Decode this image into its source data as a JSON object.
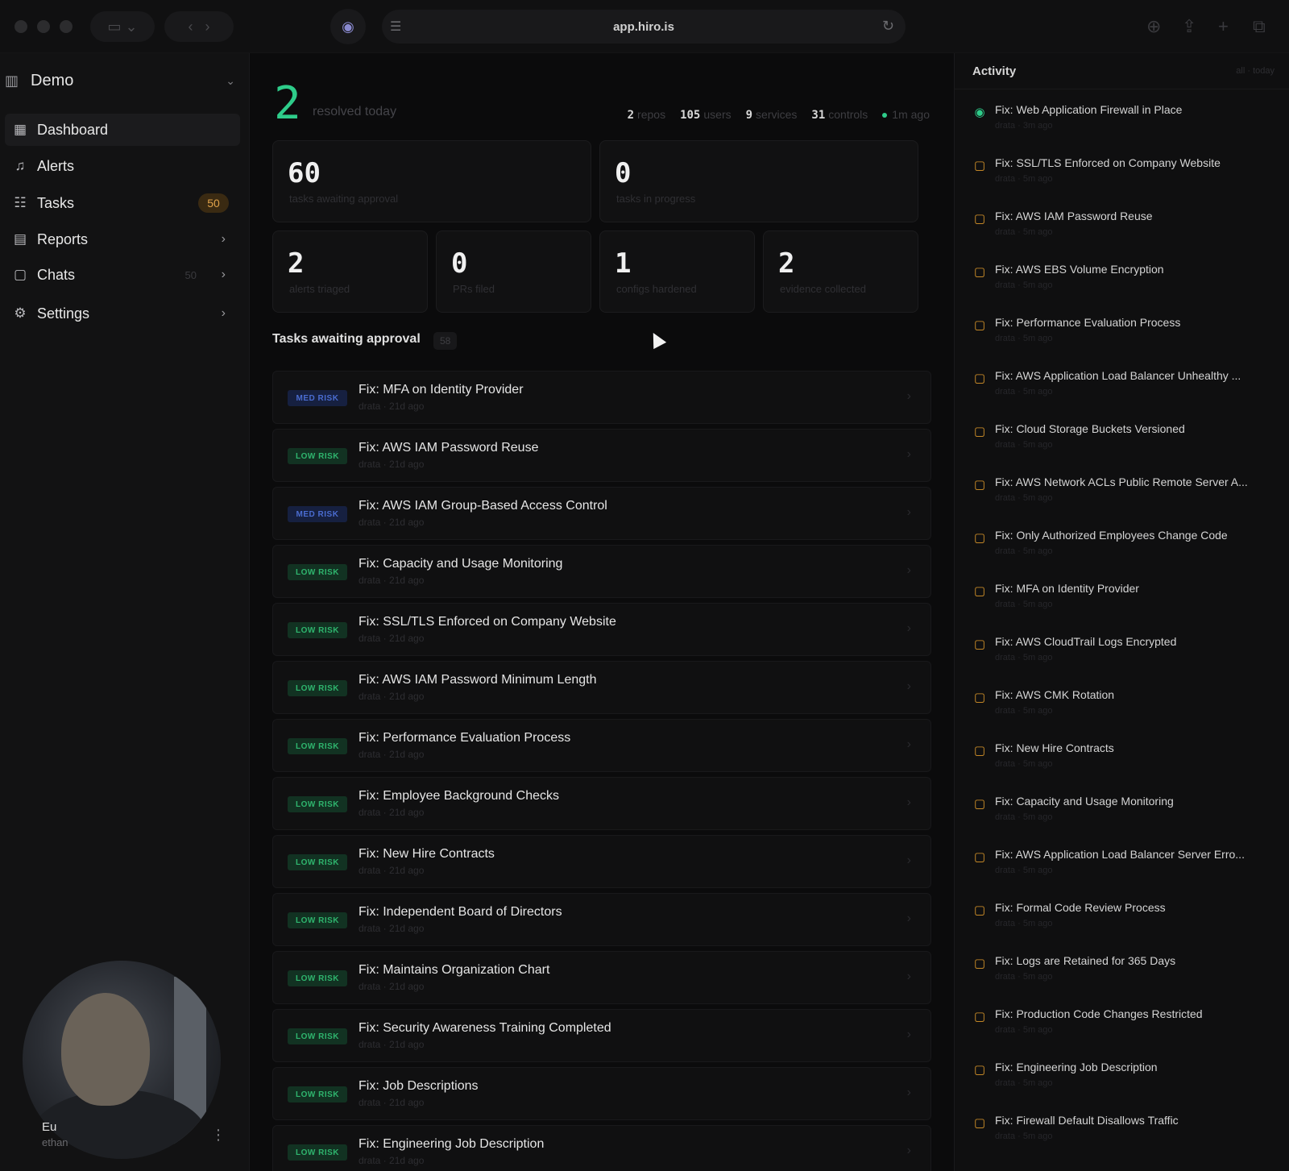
{
  "browser": {
    "url": "app.hiro.is"
  },
  "sidebar": {
    "org_name": "Demo",
    "items": [
      {
        "label": "Dashboard",
        "icon": "dashboard-icon",
        "active": true
      },
      {
        "label": "Alerts",
        "icon": "bell-icon"
      },
      {
        "label": "Tasks",
        "icon": "tasks-icon",
        "badge": "50"
      },
      {
        "label": "Reports",
        "icon": "report-icon"
      },
      {
        "label": "Chats",
        "icon": "chat-icon",
        "count": "50"
      },
      {
        "label": "Settings",
        "icon": "gear-icon"
      }
    ],
    "user": {
      "name": "Eu",
      "email": "ethan"
    }
  },
  "main": {
    "resolved_count": "2",
    "resolved_label": "resolved today",
    "stats": [
      {
        "value": "2",
        "label": "repos"
      },
      {
        "value": "105",
        "label": "users"
      },
      {
        "value": "9",
        "label": "services"
      },
      {
        "value": "31",
        "label": "controls"
      }
    ],
    "live_label": "1m ago",
    "cards_top": [
      {
        "value": "60",
        "label": "tasks awaiting approval"
      },
      {
        "value": "0",
        "label": "tasks in progress"
      }
    ],
    "cards_bottom": [
      {
        "value": "2",
        "label": "alerts triaged"
      },
      {
        "value": "0",
        "label": "PRs filed"
      },
      {
        "value": "1",
        "label": "configs hardened"
      },
      {
        "value": "2",
        "label": "evidence collected"
      }
    ],
    "section_title": "Tasks awaiting approval",
    "section_count": "58",
    "tasks": [
      {
        "risk": "MED RISK",
        "level": "med",
        "title": "Fix: MFA on Identity Provider",
        "meta": "drata · 21d ago"
      },
      {
        "risk": "LOW RISK",
        "level": "low",
        "title": "Fix: AWS IAM Password Reuse",
        "meta": "drata · 21d ago"
      },
      {
        "risk": "MED RISK",
        "level": "med",
        "title": "Fix: AWS IAM Group-Based Access Control",
        "meta": "drata · 21d ago"
      },
      {
        "risk": "LOW RISK",
        "level": "low",
        "title": "Fix: Capacity and Usage Monitoring",
        "meta": "drata · 21d ago"
      },
      {
        "risk": "LOW RISK",
        "level": "low",
        "title": "Fix: SSL/TLS Enforced on Company Website",
        "meta": "drata · 21d ago"
      },
      {
        "risk": "LOW RISK",
        "level": "low",
        "title": "Fix: AWS IAM Password Minimum Length",
        "meta": "drata · 21d ago"
      },
      {
        "risk": "LOW RISK",
        "level": "low",
        "title": "Fix: Performance Evaluation Process",
        "meta": "drata · 21d ago"
      },
      {
        "risk": "LOW RISK",
        "level": "low",
        "title": "Fix: Employee Background Checks",
        "meta": "drata · 21d ago"
      },
      {
        "risk": "LOW RISK",
        "level": "low",
        "title": "Fix: New Hire Contracts",
        "meta": "drata · 21d ago"
      },
      {
        "risk": "LOW RISK",
        "level": "low",
        "title": "Fix: Independent Board of Directors",
        "meta": "drata · 21d ago"
      },
      {
        "risk": "LOW RISK",
        "level": "low",
        "title": "Fix: Maintains Organization Chart",
        "meta": "drata · 21d ago"
      },
      {
        "risk": "LOW RISK",
        "level": "low",
        "title": "Fix: Security Awareness Training Completed",
        "meta": "drata · 21d ago"
      },
      {
        "risk": "LOW RISK",
        "level": "low",
        "title": "Fix: Job Descriptions",
        "meta": "drata · 21d ago"
      },
      {
        "risk": "LOW RISK",
        "level": "low",
        "title": "Fix: Engineering Job Description",
        "meta": "drata · 21d ago"
      }
    ]
  },
  "activity": {
    "title": "Activity",
    "filter": "all · today",
    "items": [
      {
        "text": "Fix: Web Application Firewall in Place",
        "meta": "drata · 3m ago",
        "status": "done"
      },
      {
        "text": "Fix: SSL/TLS Enforced on Company Website",
        "meta": "drata · 5m ago"
      },
      {
        "text": "Fix: AWS IAM Password Reuse",
        "meta": "drata · 5m ago"
      },
      {
        "text": "Fix: AWS EBS Volume Encryption",
        "meta": "drata · 5m ago"
      },
      {
        "text": "Fix: Performance Evaluation Process",
        "meta": "drata · 5m ago"
      },
      {
        "text": "Fix: AWS Application Load Balancer Unhealthy ...",
        "meta": "drata · 5m ago"
      },
      {
        "text": "Fix: Cloud Storage Buckets Versioned",
        "meta": "drata · 5m ago"
      },
      {
        "text": "Fix: AWS Network ACLs Public Remote Server A...",
        "meta": "drata · 5m ago"
      },
      {
        "text": "Fix: Only Authorized Employees Change Code",
        "meta": "drata · 5m ago"
      },
      {
        "text": "Fix: MFA on Identity Provider",
        "meta": "drata · 5m ago"
      },
      {
        "text": "Fix: AWS CloudTrail Logs Encrypted",
        "meta": "drata · 5m ago"
      },
      {
        "text": "Fix: AWS CMK Rotation",
        "meta": "drata · 5m ago"
      },
      {
        "text": "Fix: New Hire Contracts",
        "meta": "drata · 5m ago"
      },
      {
        "text": "Fix: Capacity and Usage Monitoring",
        "meta": "drata · 5m ago"
      },
      {
        "text": "Fix: AWS Application Load Balancer Server Erro...",
        "meta": "drata · 5m ago"
      },
      {
        "text": "Fix: Formal Code Review Process",
        "meta": "drata · 5m ago"
      },
      {
        "text": "Fix: Logs are Retained for 365 Days",
        "meta": "drata · 5m ago"
      },
      {
        "text": "Fix: Production Code Changes Restricted",
        "meta": "drata · 5m ago"
      },
      {
        "text": "Fix: Engineering Job Description",
        "meta": "drata · 5m ago"
      },
      {
        "text": "Fix: Firewall Default Disallows Traffic",
        "meta": "drata · 5m ago"
      }
    ]
  }
}
